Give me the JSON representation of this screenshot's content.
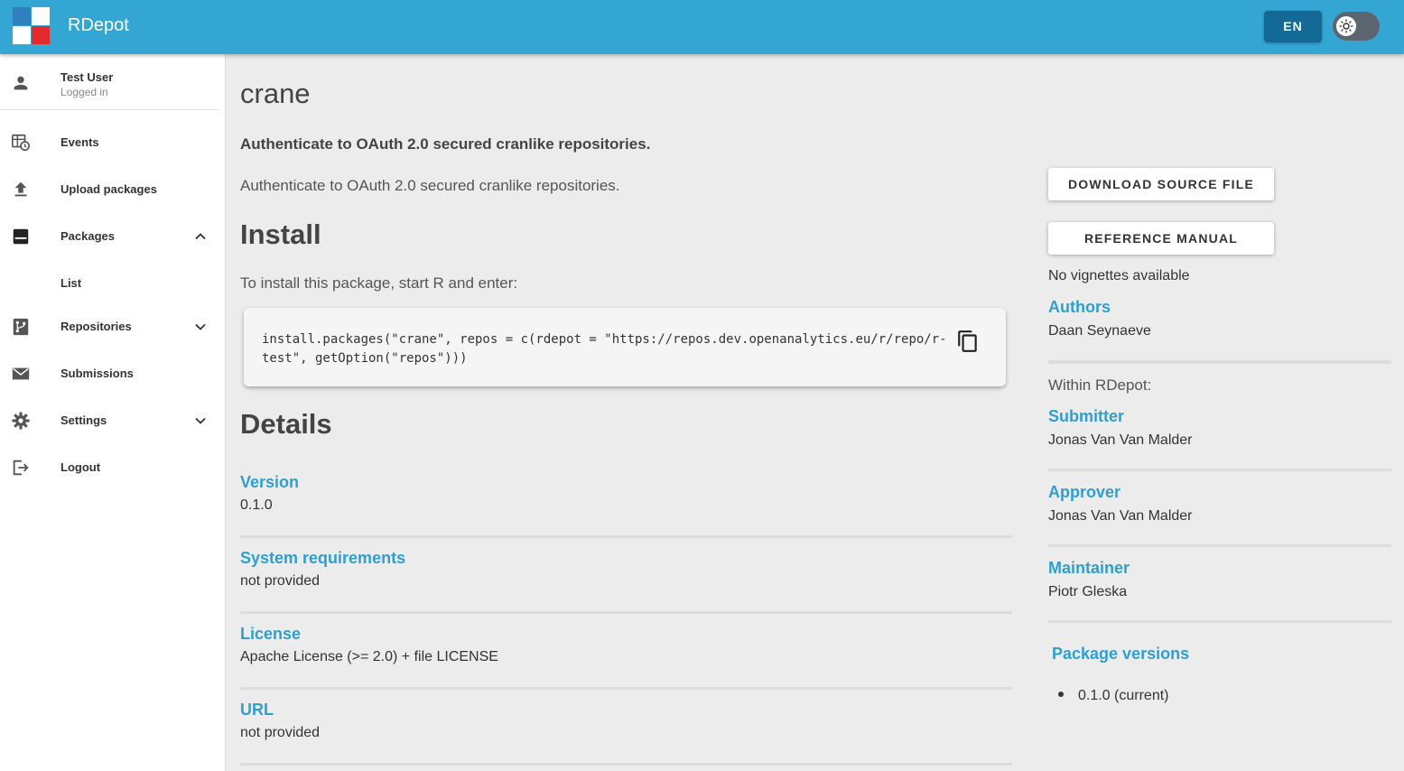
{
  "header": {
    "app_title": "RDepot",
    "lang_label": "EN",
    "logo_colors": [
      "#2f7fc1",
      "#ffffff",
      "#ffffff",
      "#e32b2b"
    ]
  },
  "sidebar": {
    "user": {
      "name": "Test User",
      "status": "Logged in",
      "icon": "person-icon"
    },
    "items": [
      {
        "label": "Events",
        "icon": "events-table-clock-icon"
      },
      {
        "label": "Upload packages",
        "icon": "upload-icon"
      },
      {
        "label": "Packages",
        "icon": "package-box-icon",
        "expanded": true
      },
      {
        "label": "List",
        "icon": ""
      },
      {
        "label": "Repositories",
        "icon": "source-branch-icon",
        "expanded": false
      },
      {
        "label": "Submissions",
        "icon": "envelope-icon"
      },
      {
        "label": "Settings",
        "icon": "gear-icon",
        "expanded": false
      },
      {
        "label": "Logout",
        "icon": "logout-icon"
      }
    ]
  },
  "main": {
    "title": "crane",
    "subtitle": "Authenticate to OAuth 2.0 secured cranlike repositories.",
    "description": "Authenticate to OAuth 2.0 secured cranlike repositories.",
    "install_heading": "Install",
    "install_text": "To install this package, start R and enter:",
    "code": "install.packages(\"crane\", repos = c(rdepot = \"https://repos.dev.openanalytics.eu/r/repo/r-test\", getOption(\"repos\")))",
    "details_heading": "Details",
    "details": [
      {
        "label": "Version",
        "value": "0.1.0"
      },
      {
        "label": "System requirements",
        "value": "not provided"
      },
      {
        "label": "License",
        "value": "Apache License (>= 2.0) + file LICENSE"
      },
      {
        "label": "URL",
        "value": "not provided"
      }
    ]
  },
  "right": {
    "download_button": "DOWNLOAD SOURCE FILE",
    "manual_button": "REFERENCE MANUAL",
    "vignettes_text": "No vignettes available",
    "authors_label": "Authors",
    "authors_value": "Daan Seynaeve",
    "within_label": "Within RDepot:",
    "submitter_label": "Submitter",
    "submitter_value": "Jonas Van Van Malder",
    "approver_label": "Approver",
    "approver_value": "Jonas Van Van Malder",
    "maintainer_label": "Maintainer",
    "maintainer_value": "Piotr Gleska",
    "versions_label": "Package versions",
    "versions": [
      "0.1.0 (current)"
    ]
  },
  "colors": {
    "topbar": "#34a6d4",
    "accent": "#2e9fd0",
    "lang_button": "#136a96"
  }
}
